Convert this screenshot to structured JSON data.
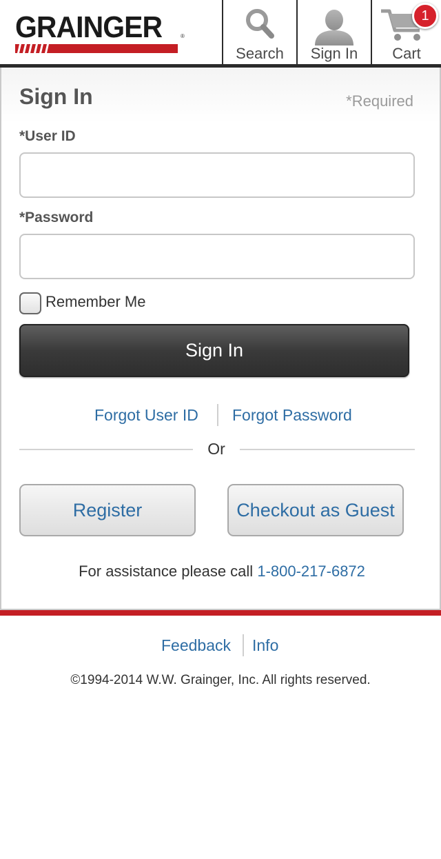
{
  "header": {
    "logo_text": "GRAINGER",
    "logo_mark": "®",
    "nav": {
      "search_label": "Search",
      "signin_label": "Sign In",
      "cart_label": "Cart",
      "cart_count": "1"
    },
    "brand_colors": {
      "red": "#c41e24",
      "dark": "#2b2b2b"
    }
  },
  "form": {
    "title": "Sign In",
    "required_note": "*Required",
    "user_id_label": "*User ID",
    "user_id_value": "",
    "password_label": "*Password",
    "password_value": "",
    "remember_label": "Remember Me",
    "remember_checked": false,
    "submit_label": "Sign In",
    "forgot_user_label": "Forgot User ID",
    "forgot_password_label": "Forgot Password",
    "or_label": "Or",
    "register_label": "Register",
    "guest_label": "Checkout as Guest",
    "assist_text": "For assistance please call",
    "assist_phone": "1-800-217-6872"
  },
  "footer": {
    "feedback_label": "Feedback",
    "info_label": "Info",
    "copyright": "©1994-2014 W.W. Grainger, Inc. All rights reserved."
  },
  "icons": {
    "search": "search-icon",
    "signin": "user-silhouette-icon",
    "cart": "cart-icon"
  },
  "colors": {
    "link": "#2e6da4",
    "badge": "#d6212b"
  }
}
